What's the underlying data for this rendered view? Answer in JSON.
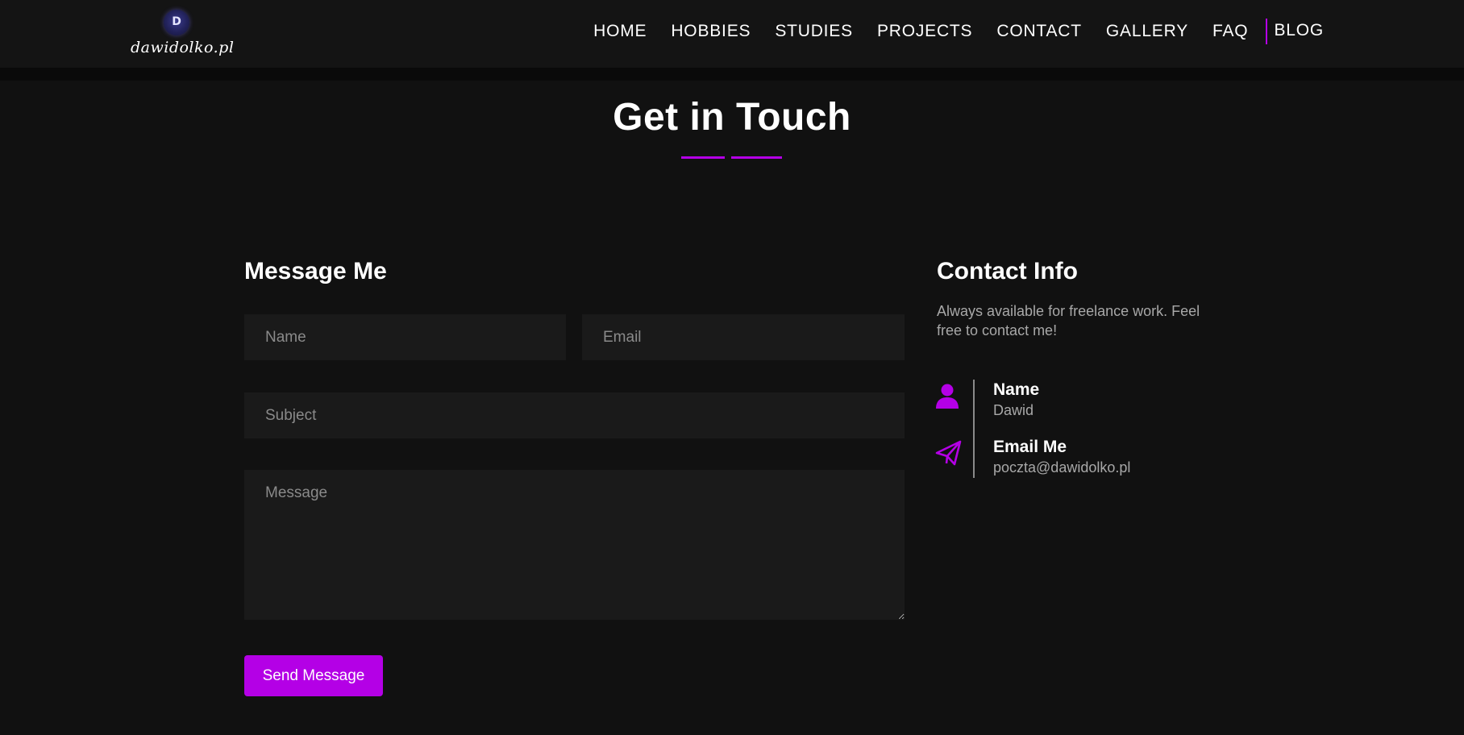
{
  "header": {
    "logo": {
      "badge_letter": "D",
      "text": "dawidolko.pl"
    },
    "nav": [
      "HOME",
      "HOBBIES",
      "STUDIES",
      "PROJECTS",
      "CONTACT",
      "GALLERY",
      "FAQ",
      "BLOG"
    ]
  },
  "page": {
    "title": "Get in Touch"
  },
  "form": {
    "heading": "Message Me",
    "name_placeholder": "Name",
    "email_placeholder": "Email",
    "subject_placeholder": "Subject",
    "message_placeholder": "Message",
    "submit_label": "Send Message"
  },
  "contact_info": {
    "heading": "Contact Info",
    "description": "Always available for freelance work. Feel free to contact me!",
    "items": [
      {
        "icon": "person-icon",
        "label": "Name",
        "value": "Dawid"
      },
      {
        "icon": "paper-plane-icon",
        "label": "Email Me",
        "value": "poczta@dawidolko.pl"
      }
    ]
  },
  "colors": {
    "accent": "#b400e6",
    "background": "#111111",
    "field_background": "#1a1a1a",
    "muted_text": "#a8a8a8"
  }
}
